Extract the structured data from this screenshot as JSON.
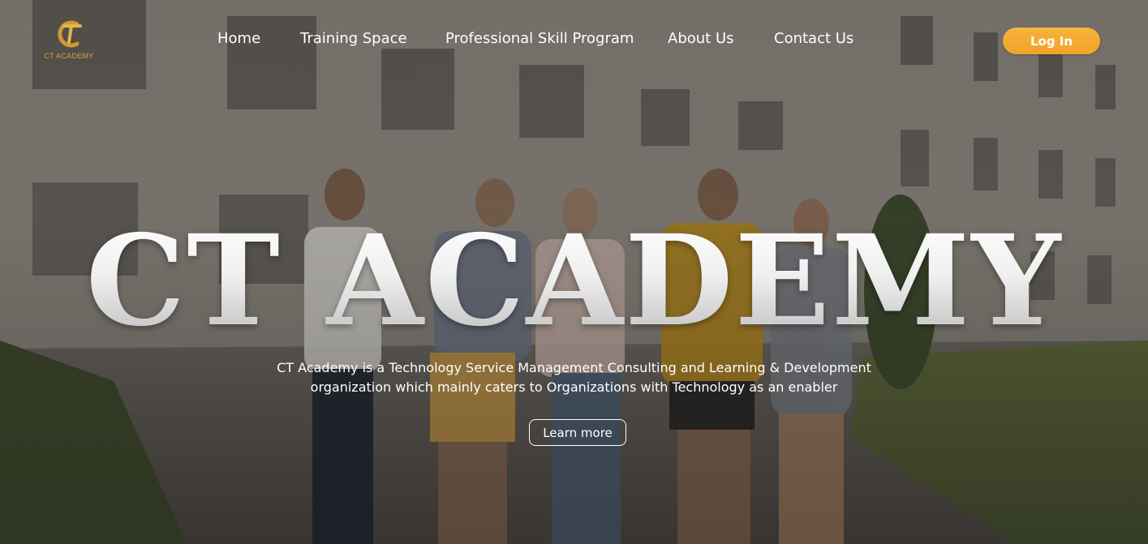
{
  "brand": {
    "logo_icon": "ct-academy-logo-icon",
    "logo_text": "CT ACADEMY",
    "accent_color": "#f2a630"
  },
  "nav": {
    "items": [
      {
        "label": "Home"
      },
      {
        "label": "Training Space"
      },
      {
        "label": "Professional Skill Program"
      },
      {
        "label": "About Us"
      },
      {
        "label": "Contact Us"
      }
    ],
    "login_label": "Log In"
  },
  "hero": {
    "title": "CT ACADEMY",
    "description_line1": "CT Academy is a Technology Service Management Consulting and Learning & Development",
    "description_line2": "organization which mainly caters to Organizations with Technology as an enabler",
    "cta_label": "Learn more",
    "background_image": "students-walking-campus-photo"
  }
}
